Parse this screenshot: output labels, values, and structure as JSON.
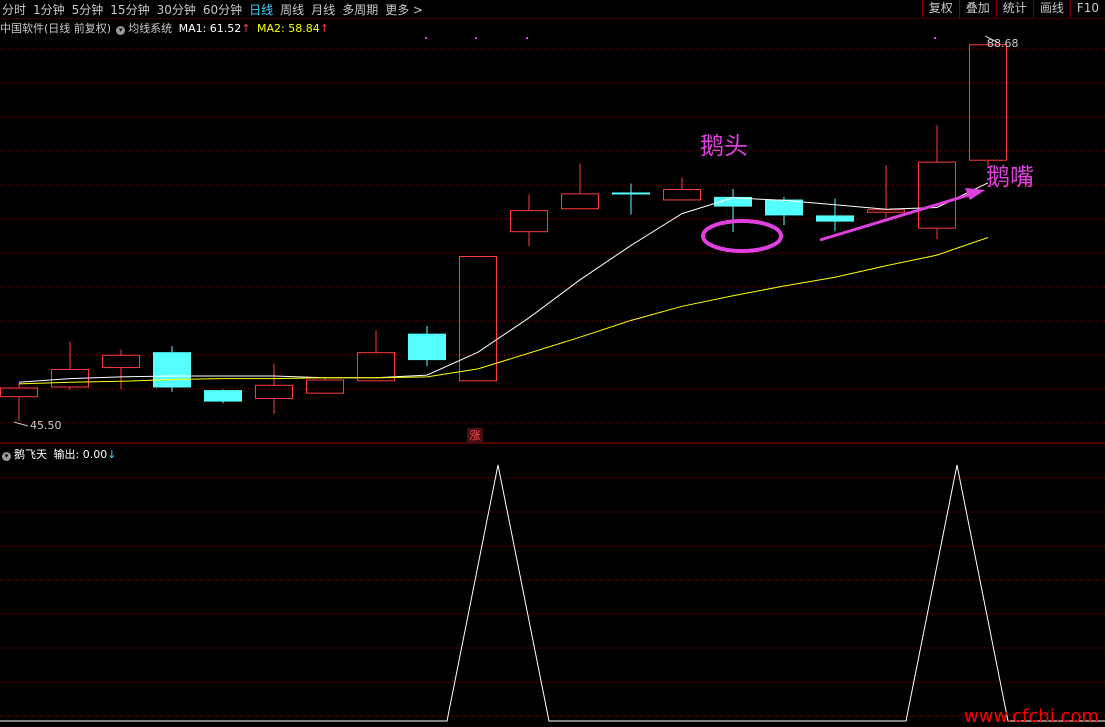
{
  "toolbar": {
    "periods": [
      "分时",
      "1分钟",
      "5分钟",
      "15分钟",
      "30分钟",
      "60分钟",
      "日线",
      "周线",
      "月线",
      "多周期",
      "更多 >"
    ],
    "active_period": "日线",
    "right_buttons": [
      "复权",
      "叠加",
      "统计",
      "画线",
      "F10"
    ]
  },
  "main_legend": {
    "stock_name": "中国软件(日线 前复权)",
    "indicator_name": "均线系统",
    "ma1_label": "MA1: 61.52",
    "ma1_arrow": "↑",
    "ma2_label": "MA2: 58.84",
    "ma2_arrow": "↑"
  },
  "indicator_legend": {
    "name": "鹅飞天",
    "output_label": "输出: 0.00",
    "output_arrow": "↓"
  },
  "price_labels": {
    "high": "88.68",
    "low": "45.50"
  },
  "annotations": {
    "goose_head": "鹅头",
    "goose_beak": "鹅嘴"
  },
  "zhang_badge": "涨",
  "watermark": "www.cfchi.com",
  "colors": {
    "up": "#ff3b3b",
    "down": "#54ffff",
    "ma1": "#ffffff",
    "ma2": "#ffff00",
    "annotation": "#e040e0",
    "grid": "#800000"
  },
  "chart_data": {
    "type": "candlestick",
    "price_range": [
      45.5,
      88.68
    ],
    "candles": [
      {
        "o": 48.2,
        "h": 49.8,
        "l": 45.5,
        "c": 49.3
      },
      {
        "o": 49.3,
        "h": 54.5,
        "l": 49.0,
        "c": 51.4
      },
      {
        "o": 51.5,
        "h": 53.6,
        "l": 49.1,
        "c": 53.0
      },
      {
        "o": 53.3,
        "h": 54.0,
        "l": 48.8,
        "c": 49.3
      },
      {
        "o": 49.0,
        "h": 49.1,
        "l": 47.5,
        "c": 47.7
      },
      {
        "o": 48.0,
        "h": 52.0,
        "l": 46.3,
        "c": 49.6
      },
      {
        "o": 48.6,
        "h": 50.3,
        "l": 48.6,
        "c": 50.2
      },
      {
        "o": 50.0,
        "h": 55.8,
        "l": 50.0,
        "c": 53.3
      },
      {
        "o": 55.4,
        "h": 56.3,
        "l": 51.7,
        "c": 52.4
      },
      {
        "o": 50.0,
        "h": 64.2,
        "l": 50.0,
        "c": 64.2
      },
      {
        "o": 66.9,
        "h": 71.2,
        "l": 65.3,
        "c": 69.4
      },
      {
        "o": 69.5,
        "h": 74.7,
        "l": 69.5,
        "c": 71.3
      },
      {
        "o": 71.4,
        "h": 72.4,
        "l": 68.9,
        "c": 71.3
      },
      {
        "o": 70.5,
        "h": 73.1,
        "l": 70.5,
        "c": 71.8
      },
      {
        "o": 70.9,
        "h": 71.8,
        "l": 66.9,
        "c": 69.8
      },
      {
        "o": 70.6,
        "h": 70.9,
        "l": 67.7,
        "c": 68.8
      },
      {
        "o": 68.8,
        "h": 70.7,
        "l": 67.0,
        "c": 68.1
      },
      {
        "o": 69.1,
        "h": 74.5,
        "l": 68.5,
        "c": 69.5
      },
      {
        "o": 67.3,
        "h": 79.0,
        "l": 66.1,
        "c": 74.9
      },
      {
        "o": 75.0,
        "h": 88.68,
        "l": 74.2,
        "c": 88.2
      }
    ],
    "ma1": [
      49.9,
      50.3,
      50.5,
      50.6,
      50.6,
      50.6,
      50.4,
      50.4,
      50.7,
      53.3,
      57.2,
      61.5,
      65.4,
      69.0,
      70.8,
      70.5,
      70.0,
      69.5,
      69.7,
      72.5
    ],
    "ma2": [
      49.7,
      49.9,
      50.0,
      50.2,
      50.3,
      50.3,
      50.4,
      50.4,
      50.5,
      51.4,
      53.2,
      55.0,
      56.9,
      58.5,
      59.7,
      60.8,
      61.8,
      63.1,
      64.3,
      66.3
    ],
    "indicator": [
      0,
      0,
      0,
      0,
      0,
      0,
      0,
      0,
      0,
      1,
      0,
      0,
      0,
      0,
      0,
      0,
      0,
      0,
      1,
      0
    ]
  }
}
